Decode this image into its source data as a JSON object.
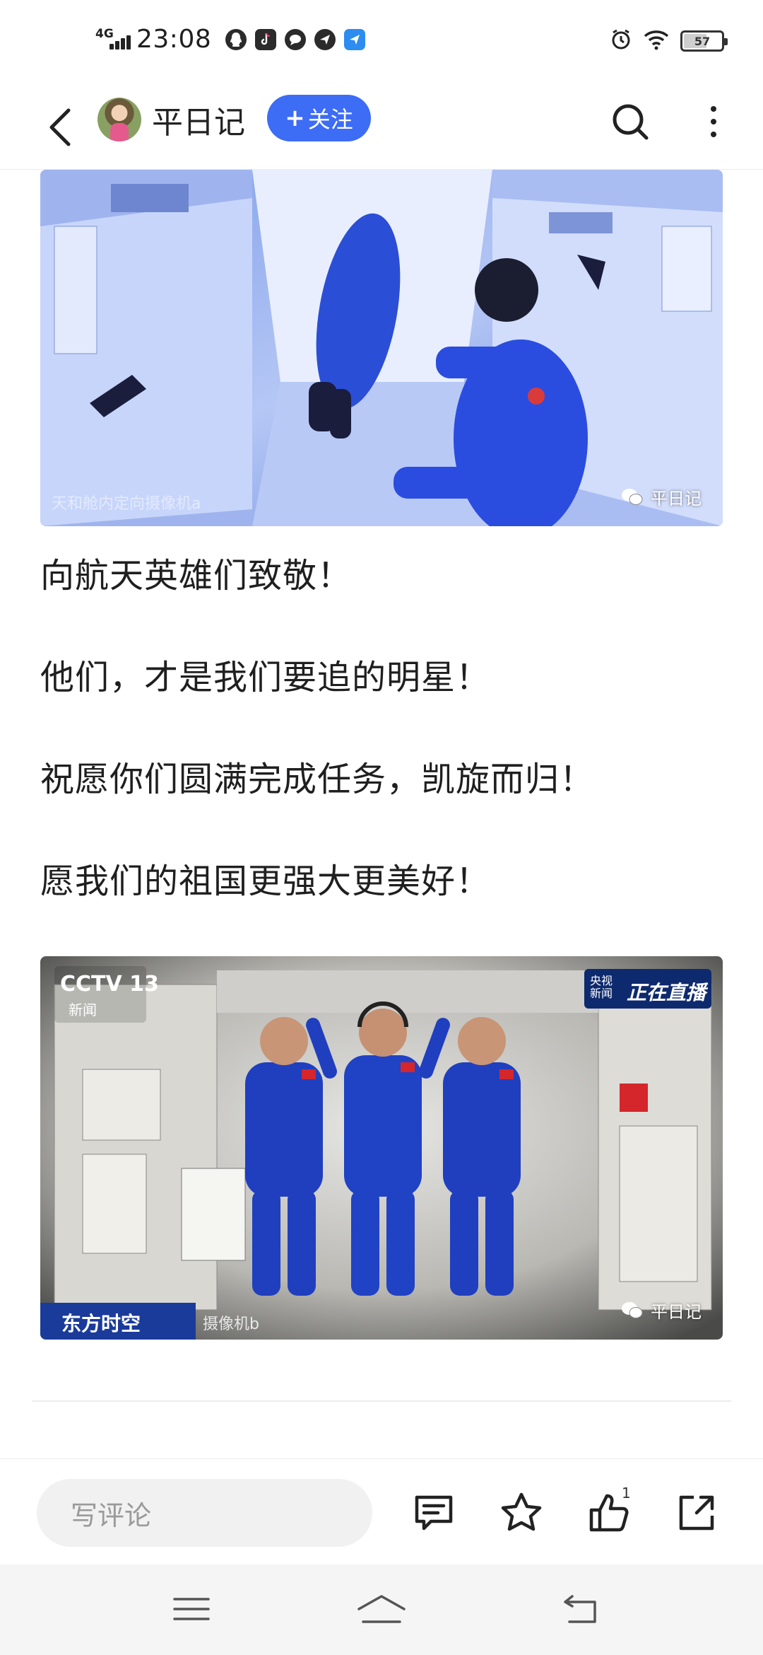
{
  "status_bar": {
    "network": "4G",
    "time": "23:08",
    "battery": "57",
    "battery_level": 0.57
  },
  "header": {
    "title": "平日记",
    "follow_label": "关注",
    "follow_plus": "+"
  },
  "article": {
    "image1": {
      "caption": "天和舱内定向摄像机a",
      "watermark": "平日记"
    },
    "paragraphs": [
      "向航天英雄们致敬！",
      "他们，才是我们要追的明星！",
      "祝愿你们圆满完成任务，凯旋而归！",
      "愿我们的祖国更强大更美好！"
    ],
    "image2": {
      "channel": "CCTV 13",
      "channel_sub": "新闻",
      "live_source": "央视新闻",
      "live_label": "正在直播",
      "program": "东方时空",
      "caption": "摄像机b",
      "watermark": "平日记"
    }
  },
  "action_bar": {
    "comment_placeholder": "写评论",
    "like_count": "1"
  },
  "colors": {
    "accent": "#3d6cf5",
    "text": "#1f1f1f"
  }
}
